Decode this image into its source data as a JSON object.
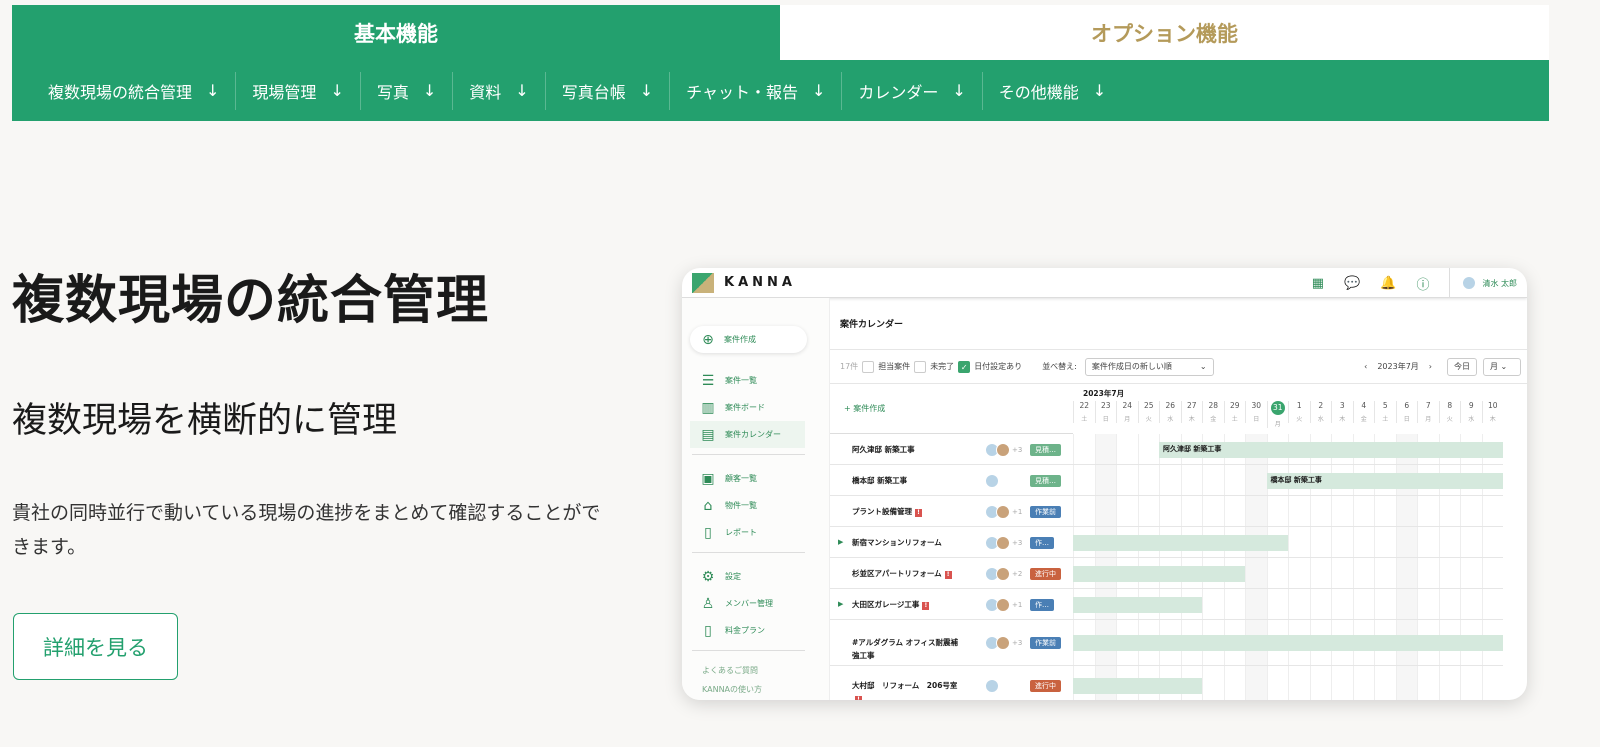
{
  "tabs": {
    "basic": "基本機能",
    "option": "オプション機能"
  },
  "subnav": [
    "複数現場の統合管理",
    "現場管理",
    "写真",
    "資料",
    "写真台帳",
    "チャット・報告",
    "カレンダー",
    "その他機能"
  ],
  "subnav_arrow": "↓",
  "hero": {
    "title": "複数現場の統合管理",
    "subtitle": "複数現場を横断的に管理",
    "description": "貴社の同時並行で動いている現場の進捗をまとめて確認することができます。",
    "button": "詳細を見る"
  },
  "app": {
    "logo": "KANNA",
    "user": "清水 太郎",
    "sidebar": {
      "create": "案件作成",
      "items": [
        "案件一覧",
        "案件ボード",
        "案件カレンダー",
        "顧客一覧",
        "物件一覧",
        "レポート",
        "設定",
        "メンバー管理",
        "料金プラン"
      ],
      "links": [
        "よくあるご質問",
        "KANNAの使い方"
      ]
    },
    "page_title": "案件カレンダー",
    "filters": {
      "count": "17件",
      "assigned": "担当案件",
      "incomplete": "未完了",
      "dated": "日付設定あり",
      "sort_label": "並べ替え:",
      "sort_value": "案件作成日の新しい順",
      "month": "2023年7月",
      "today": "今日",
      "view": "月"
    },
    "gantt_create": "+ 案件作成",
    "month_label": "2023年7月",
    "days": [
      [
        "22",
        "土"
      ],
      [
        "23",
        "日"
      ],
      [
        "24",
        "月"
      ],
      [
        "25",
        "火"
      ],
      [
        "26",
        "水"
      ],
      [
        "27",
        "木"
      ],
      [
        "28",
        "金"
      ],
      [
        "29",
        "土"
      ],
      [
        "30",
        "日"
      ],
      [
        "31",
        "月"
      ],
      [
        "1",
        "火"
      ],
      [
        "2",
        "水"
      ],
      [
        "3",
        "木"
      ],
      [
        "4",
        "金"
      ],
      [
        "5",
        "土"
      ],
      [
        "6",
        "日"
      ],
      [
        "7",
        "月"
      ],
      [
        "8",
        "火"
      ],
      [
        "9",
        "水"
      ],
      [
        "10",
        "木"
      ]
    ],
    "today_index": 9,
    "rows": [
      {
        "name": "阿久津邸 新築工事",
        "extra": "+3",
        "status": "見積…",
        "color": "#6db38a",
        "warn": false,
        "expand": false,
        "bar_start": 4,
        "bar_end": 20,
        "bar_label": "阿久津邸 新築工事"
      },
      {
        "name": "橋本邸 新築工事",
        "extra": "",
        "status": "見積…",
        "color": "#6db38a",
        "warn": false,
        "expand": false,
        "bar_start": 9,
        "bar_end": 20,
        "bar_label": "橋本邸 新築工事"
      },
      {
        "name": "プラント設備管理",
        "extra": "+1",
        "status": "作業前",
        "color": "#4a7fb5",
        "warn": true,
        "expand": false,
        "bar_start": null,
        "bar_end": null,
        "bar_label": ""
      },
      {
        "name": "新宿マンションリフォーム",
        "extra": "+3",
        "status": "作…",
        "color": "#4a7fb5",
        "warn": false,
        "expand": true,
        "bar_start": 0,
        "bar_end": 10,
        "bar_label": ""
      },
      {
        "name": "杉並区アパートリフォーム",
        "extra": "+2",
        "status": "進行中",
        "color": "#c9623f",
        "warn": true,
        "expand": false,
        "bar_start": 0,
        "bar_end": 8,
        "bar_label": ""
      },
      {
        "name": "大田区ガレージ工事",
        "extra": "+1",
        "status": "作…",
        "color": "#4a7fb5",
        "warn": true,
        "expand": true,
        "bar_start": 0,
        "bar_end": 6,
        "bar_label": ""
      },
      {
        "name": "#アルダグラム オフィス耐震補強工事",
        "extra": "+3",
        "status": "作業前",
        "color": "#4a7fb5",
        "warn": false,
        "expand": false,
        "bar_start": 0,
        "bar_end": 20,
        "bar_label": ""
      },
      {
        "name": "大村邸　リフォーム　206号室",
        "extra": "",
        "status": "進行中",
        "color": "#c9623f",
        "warn": true,
        "expand": false,
        "bar_start": 0,
        "bar_end": 6,
        "bar_label": ""
      }
    ]
  },
  "colors": {
    "brand": "#23a06e",
    "option_text": "#b49a5a"
  }
}
